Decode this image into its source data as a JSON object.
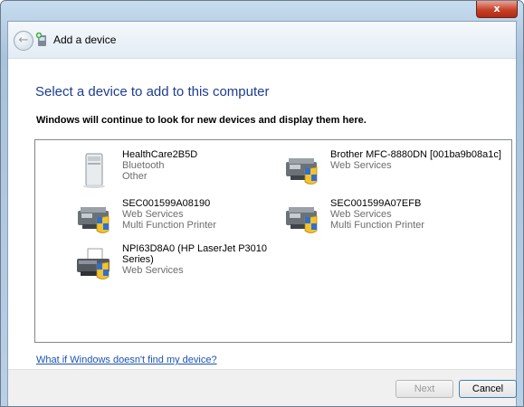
{
  "titlebar": {
    "close_label": "x"
  },
  "nav": {
    "back_glyph": "←",
    "title": "Add a device"
  },
  "heading": "Select a device to add to this computer",
  "subtext": "Windows will continue to look for new devices and display them here.",
  "devices": [
    {
      "name": "HealthCare2B5D",
      "lines": [
        "Bluetooth",
        "Other"
      ],
      "icon": "tower-computer-icon"
    },
    {
      "name": "Brother MFC-8880DN [001ba9b08a1c]",
      "lines": [
        "Web Services"
      ],
      "icon": "multifunction-printer-icon"
    },
    {
      "name": "SEC001599A08190",
      "lines": [
        "Web Services",
        "Multi Function Printer"
      ],
      "icon": "multifunction-printer-icon"
    },
    {
      "name": "SEC001599A07EFB",
      "lines": [
        "Web Services",
        "Multi Function Printer"
      ],
      "icon": "multifunction-printer-icon"
    },
    {
      "name": "NPI63D8A0 (HP LaserJet P3010 Series)",
      "lines": [
        "Web Services"
      ],
      "icon": "laser-printer-icon"
    }
  ],
  "help_link": "What if Windows doesn't find my device?",
  "buttons": {
    "next": "Next",
    "cancel": "Cancel"
  }
}
